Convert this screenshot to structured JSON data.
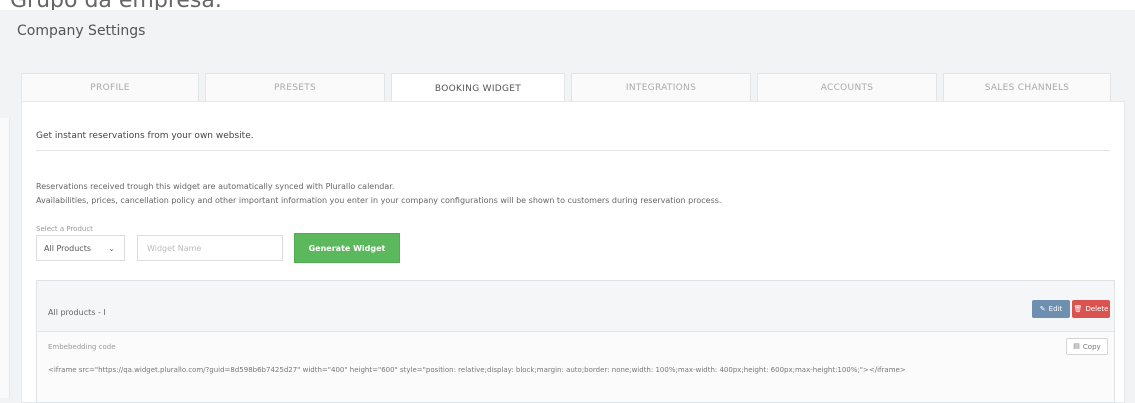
{
  "caption": "Grupo da empresa.",
  "page": {
    "title": "Company Settings"
  },
  "tabs": [
    {
      "label": "PROFILE",
      "active": false
    },
    {
      "label": "PRESETS",
      "active": false
    },
    {
      "label": "BOOKING WIDGET",
      "active": true
    },
    {
      "label": "INTEGRATIONS",
      "active": false
    },
    {
      "label": "ACCOUNTS",
      "active": false
    },
    {
      "label": "SALES CHANNELS",
      "active": false
    }
  ],
  "booking": {
    "heading": "Get instant reservations from your own website.",
    "description_1": "Reservations received trough this widget are automatically synced with Plurallo calendar.",
    "description_2": "Availabilities, prices, cancellation policy and other important information you enter in your company configurations will be shown to customers during reservation process.",
    "select_label": "Select a Product",
    "product_select": "All Products",
    "widget_name_placeholder": "Widget Name",
    "generate_button": "Generate Widget"
  },
  "widget_card": {
    "title": "All products - I",
    "edit_label": "Edit",
    "delete_label": "Delete",
    "embed_label": "Embebedding code",
    "copy_label": "Copy",
    "embed_code": "<iframe src=\"https://qa.widget.plurallo.com/?guid=8d598b6b7425d27\" width=\"400\" height=\"600\" style=\"position: relative;display: block;margin: auto;border: none;width: 100%;max-width: 400px;height: 600px;max-height:100%;\"></iframe>"
  },
  "colors": {
    "accent_green": "#5cb85c",
    "edit_blue": "#6d8fb0",
    "delete_red": "#d9534f"
  },
  "icons": {
    "select_chevron": "chevron-down-icon",
    "edit": "pencil-icon",
    "delete": "trash-icon",
    "copy": "clipboard-icon"
  }
}
